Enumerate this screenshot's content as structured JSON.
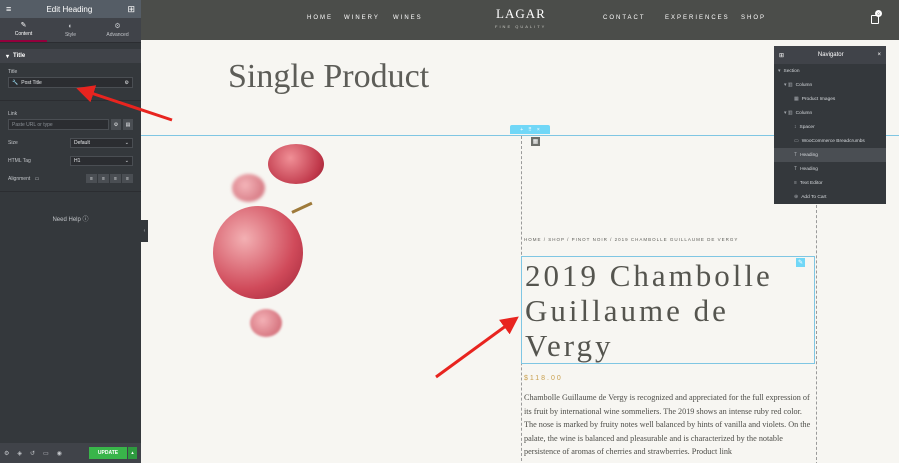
{
  "sidebar": {
    "header_title": "Edit Heading",
    "tabs": [
      {
        "label": "Content",
        "icon": "pencil-icon"
      },
      {
        "label": "Style",
        "icon": "contrast-icon"
      },
      {
        "label": "Advanced",
        "icon": "gear-icon"
      }
    ],
    "section_title": "Title",
    "title_label": "Title",
    "title_value": "Post Title",
    "link_label": "Link",
    "link_placeholder": "Paste URL or type",
    "size_label": "Size",
    "size_value": "Default",
    "html_tag_label": "HTML Tag",
    "html_tag_value": "H1",
    "alignment_label": "Alignment",
    "need_help": "Need Help",
    "update_label": "UPDATE"
  },
  "site": {
    "nav_left": [
      "HOME",
      "WINERY",
      "WINES"
    ],
    "nav_right": [
      "CONTACT",
      "EXPERIENCES",
      "SHOP"
    ],
    "logo": "LAGAR",
    "logo_sub": "FINE QUALITY",
    "cart_count": "0",
    "page_title": "Single Product",
    "breadcrumbs": "HOME / SHOP / PINOT NOIR / 2019 CHAMBOLLE GUILLAUME DE VERGY",
    "product_title": "2019 Chambolle Guillaume de Vergy",
    "price": "$118.00",
    "description": "Chambolle Guillaume de Vergy is recognized and appreciated for the full expression of its fruit by international wine sommeliers. The 2019 shows an intense ruby red color. The nose is marked by fruity notes well balanced by hints of vanilla and violets. On the palate, the wine is balanced and pleasurable and is characterized by the notable persistence of aromas of cherries and strawberries. Product link"
  },
  "navigator": {
    "title": "Navigator",
    "items": [
      {
        "label": "Section",
        "icon": "chevron-down-icon"
      },
      {
        "label": "Column",
        "icon": "column-icon"
      },
      {
        "label": "Product Images",
        "icon": "images-icon"
      },
      {
        "label": "Column",
        "icon": "column-icon"
      },
      {
        "label": "Spacer",
        "icon": "spacer-icon"
      },
      {
        "label": "WooCommerce Breadcrumbs",
        "icon": "breadcrumbs-icon"
      },
      {
        "label": "Heading",
        "icon": "heading-icon"
      },
      {
        "label": "Heading",
        "icon": "heading-icon"
      },
      {
        "label": "Text Editor",
        "icon": "text-editor-icon"
      },
      {
        "label": "Add To Cart",
        "icon": "cart-icon"
      }
    ]
  },
  "colors": {
    "sidebar_bg": "#34383c",
    "header_bg": "#4b4d4a",
    "accent_blue": "#71d7f7",
    "update_green": "#39b54a",
    "price_gold": "#c9a04e",
    "arrow_red": "#e8241f"
  }
}
